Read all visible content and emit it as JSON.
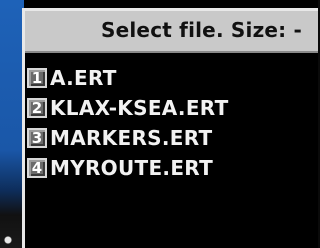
{
  "dialog": {
    "title": "Select file. Size: -"
  },
  "files": [
    {
      "key": "1",
      "name": "A.ERT"
    },
    {
      "key": "2",
      "name": "KLAX-KSEA.ERT"
    },
    {
      "key": "3",
      "name": "MARKERS.ERT"
    },
    {
      "key": "4",
      "name": "MYROUTE.ERT"
    }
  ],
  "colors": {
    "titlebar_bg": "#c9c9c9",
    "list_bg": "#000000",
    "text": "#f2f2f2",
    "key_bg": "#6a6a6a",
    "desktop": "#1e62b8"
  }
}
